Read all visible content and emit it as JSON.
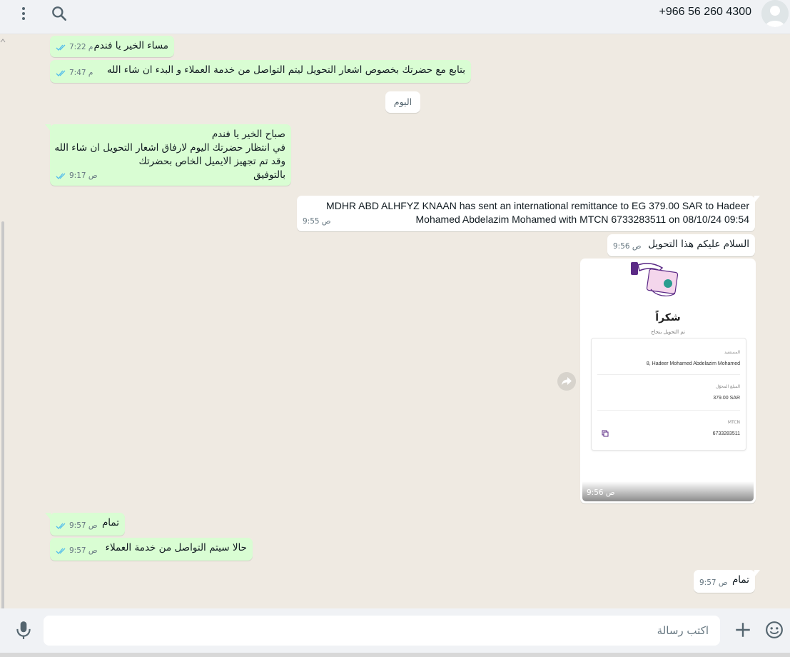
{
  "header": {
    "phone": "+966 56 260 4300",
    "menu_icon": "more-vert-icon",
    "search_icon": "search-icon",
    "avatar_icon": "default-avatar-icon"
  },
  "date_divider": "اليوم",
  "messages": [
    {
      "dir": "out",
      "lines": [
        "مساء الخير يا فندم"
      ],
      "time": "7:22 م"
    },
    {
      "dir": "out",
      "lines": [
        "بتابع مع حضرتك بخصوص اشعار التحويل ليتم التواصل من خدمة العملاء و البدء ان شاء الله"
      ],
      "time": "7:47 م"
    },
    {
      "dir": "out",
      "lines": [
        "صباح الخير يا فندم",
        "في انتظار حضرتك اليوم لارفاق اشعار التحويل ان شاء الله",
        "وقد تم تجهيز الايميل الخاص بحضرتك",
        "بالتوفيق"
      ],
      "time": "9:17 ص"
    },
    {
      "dir": "in",
      "lines": [
        "MDHR ABD ALHFYZ KNAAN has sent an international remittance to EG 379.00 SAR to Hadeer",
        "Mohamed Abdelazim Mohamed with MTCN 6733283511 on 08/10/24 09:54"
      ],
      "time": "9:55 ص"
    },
    {
      "dir": "in",
      "lines": [
        "السلام عليكم هذا التحويل"
      ],
      "time": "9:56 ص"
    },
    {
      "dir": "out",
      "lines": [
        "تمام"
      ],
      "time": "9:57 ص"
    },
    {
      "dir": "out",
      "lines": [
        "حالا سيتم التواصل من خدمة العملاء"
      ],
      "time": "9:57 ص"
    },
    {
      "dir": "in",
      "lines": [
        "تمام"
      ],
      "time": "9:57 ص"
    }
  ],
  "image_message": {
    "title": "شكراً",
    "subtitle": "تم التحويل بنجاح",
    "beneficiary_label": "المستفيد",
    "beneficiary_value": "8, Hadeer Mohamed Abdelazim Mohamed",
    "amount_label": "المبلغ المحوّل",
    "amount_value": "379.00 SAR",
    "mtcn_label": "MTCN",
    "mtcn_value": "6733283511",
    "time": "9:56 ص",
    "forward_icon": "forward-icon"
  },
  "composer": {
    "placeholder": "اكتب رسالة",
    "mic_icon": "mic-icon",
    "plus_icon": "plus-icon",
    "emoji_icon": "emoji-icon"
  },
  "colors": {
    "outgoing_bubble": "#d9fdd3",
    "incoming_bubble": "#ffffff",
    "chat_bg": "#efeae2",
    "read_tick": "#53bdeb"
  }
}
